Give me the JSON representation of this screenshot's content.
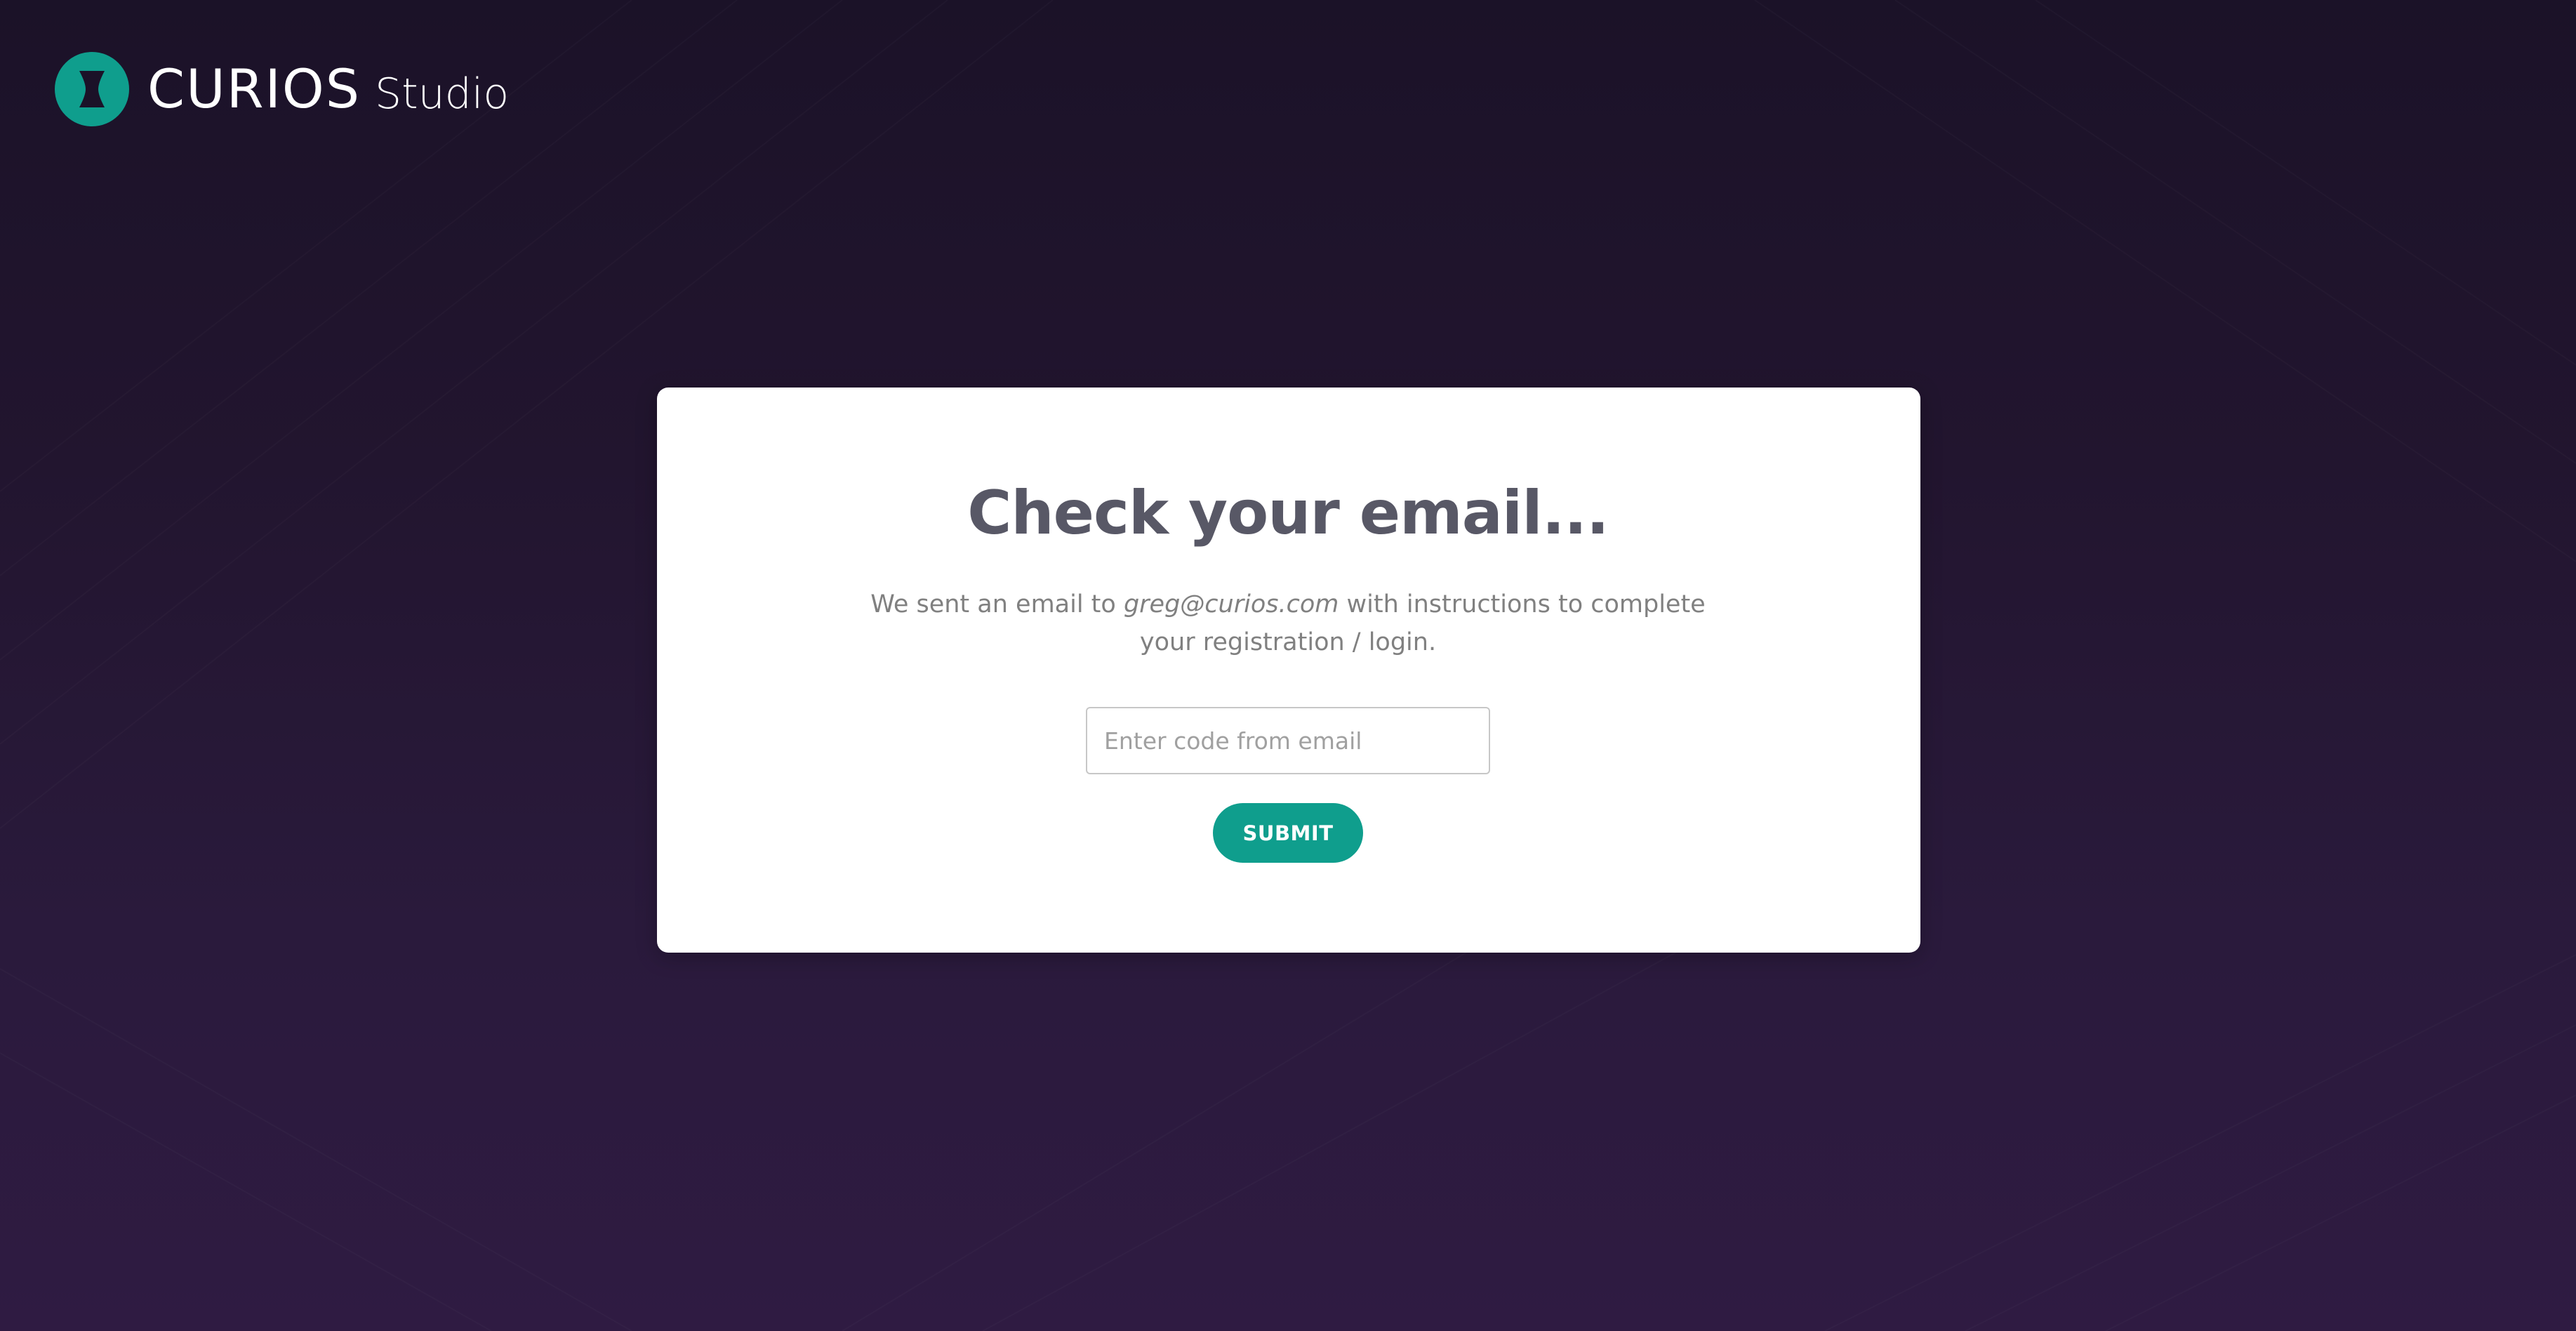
{
  "brand": {
    "name": "CURIOS",
    "product": "Studio",
    "icon": "curios-logo-icon",
    "accent_color": "#0f9e8d"
  },
  "card": {
    "title": "Check your email...",
    "message_prefix": "We sent an email to ",
    "email": "greg@curios.com",
    "message_suffix": " with instructions to complete your registration / login."
  },
  "code_input": {
    "value": "",
    "placeholder": "Enter code from email"
  },
  "submit": {
    "label": "SUBMIT"
  }
}
